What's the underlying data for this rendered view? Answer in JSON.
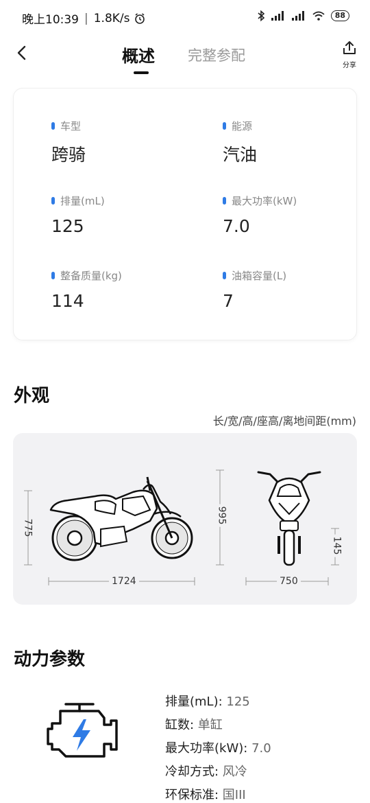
{
  "status_bar": {
    "time": "晚上10:39",
    "speed": "1.8K/s",
    "battery": "88"
  },
  "nav": {
    "tab_overview": "概述",
    "tab_full_specs": "完整参配",
    "share_label": "分享"
  },
  "summary": [
    {
      "label": "车型",
      "value": "跨骑"
    },
    {
      "label": "能源",
      "value": "汽油"
    },
    {
      "label": "排量(mL)",
      "value": "125"
    },
    {
      "label": "最大功率(kW)",
      "value": "7.0"
    },
    {
      "label": "整备质量(kg)",
      "value": "114"
    },
    {
      "label": "油箱容量(L)",
      "value": "7"
    }
  ],
  "appearance": {
    "title": "外观",
    "caption": "长/宽/高/座高/离地间距(mm)",
    "length": "1724",
    "seat_height": "775",
    "height": "995",
    "width": "750",
    "ground_clearance": "145"
  },
  "power": {
    "title": "动力参数",
    "rows": [
      {
        "label": "排量(mL): ",
        "value": "125"
      },
      {
        "label": "缸数: ",
        "value": "单缸"
      },
      {
        "label": "最大功率(kW): ",
        "value": "7.0"
      },
      {
        "label": "冷却方式: ",
        "value": "风冷"
      },
      {
        "label": "环保标准: ",
        "value": "国III"
      }
    ]
  }
}
